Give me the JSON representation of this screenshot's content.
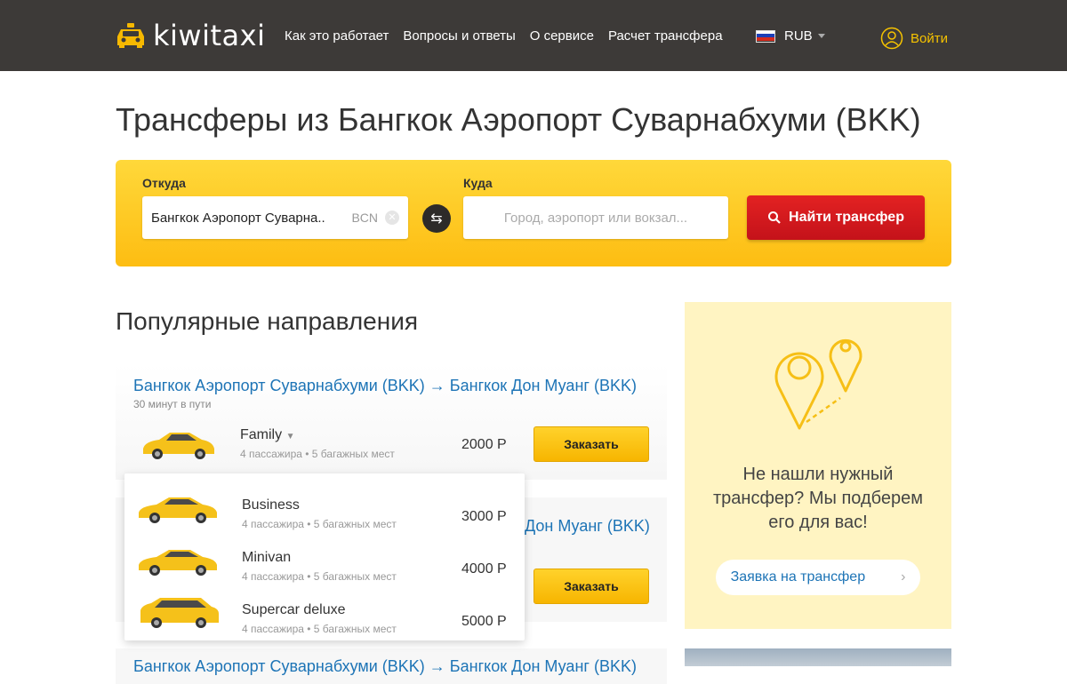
{
  "header": {
    "logo_text": "kiwitaxi",
    "nav": [
      "Как это работает",
      "Вопросы и ответы",
      "О сервисе",
      "Расчет трансфера"
    ],
    "currency": "RUB",
    "login": "Войти"
  },
  "page_title": "Трансферы из Бангкок Аэропорт Суварнабхуми (BKK)",
  "search": {
    "from_label": "Откуда",
    "from_value": "Бангкок Аэропорт Суварна..",
    "from_code": "BCN",
    "to_label": "Куда",
    "to_placeholder": "Город, аэропорт или вокзал...",
    "find_label": "Найти трансфер"
  },
  "popular": {
    "title": "Популярные направления",
    "routes": [
      {
        "title": "Бангкок Аэропорт Суварнабхуми (BKK) → Бангкок Дон Муанг (BKK)",
        "duration": "30 минут в пути",
        "car": "Family",
        "meta": "4 пассажира • 5 багажных мест",
        "price": "2000 Р",
        "order": "Заказать"
      },
      {
        "title_visible": "Дон Муанг (BKK)",
        "order": "Заказать"
      },
      {
        "title": "Бангкок Аэропорт Суварнабхуми (BKK) → Бангкок Дон Муанг (BKK)"
      }
    ],
    "dropdown": [
      {
        "car": "Business",
        "meta": "4 пассажира • 5 багажных мест",
        "price": "3000 Р"
      },
      {
        "car": "Minivan",
        "meta": "4 пассажира • 5 багажных мест",
        "price": "4000 Р"
      },
      {
        "car": "Supercar deluxe",
        "meta": "4 пассажира • 5 багажных мест",
        "price": "5000 Р"
      }
    ]
  },
  "promo": {
    "text": "Не нашли нужный трансфер? Мы подберем его для вас!",
    "button": "Заявка на трансфер"
  },
  "colors": {
    "header_bg": "#3d3a38",
    "accent_yellow": "#fdbd12",
    "link_blue": "#1d74b6",
    "search_red": "#d01a1e"
  }
}
